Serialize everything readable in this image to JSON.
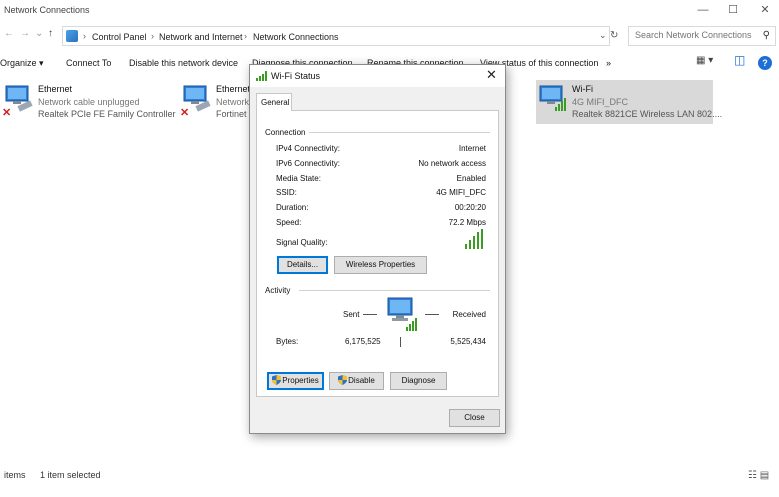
{
  "window": {
    "title": "Network Connections",
    "controls": {
      "minimize": "—",
      "maximize": "☐",
      "close": "✕"
    }
  },
  "address": {
    "back": "←",
    "forward": "→",
    "recent": "⌄",
    "up": "↑",
    "breadcrumbs": [
      "Control Panel",
      "Network and Internet",
      "Network Connections"
    ],
    "separator": "›",
    "dropdown": "⌄",
    "refresh": "↻",
    "search_placeholder": "Search Network Connections",
    "search_icon": "⚲"
  },
  "toolbar": {
    "organize": "Organize ▾",
    "connect_to": "Connect To",
    "disable": "Disable this network device",
    "diagnose": "Diagnose this connection",
    "rename": "Rename this connection",
    "view_status": "View status of this connection",
    "more": "»",
    "view_icon": "▦ ▾",
    "pane_icon": "◫",
    "help": "?"
  },
  "connections": [
    {
      "name": "Ethernet",
      "status": "Network cable unplugged",
      "device": "Realtek PCIe FE Family Controller",
      "error": "✕"
    },
    {
      "name": "Ethernet",
      "status": "Network",
      "device": "Fortinet",
      "error": "✕"
    },
    {
      "name": "Wi-Fi",
      "status": "4G MIFI_DFC",
      "device": "Realtek 8821CE Wireless LAN 802...."
    }
  ],
  "status_bar": {
    "items": "items",
    "selected": "1 item selected",
    "view_icons": "☷ ▤"
  },
  "dialog": {
    "title": "Wi-Fi Status",
    "close": "✕",
    "tab": "General",
    "connection_header": "Connection",
    "rows": [
      {
        "label": "IPv4 Connectivity:",
        "value": "Internet"
      },
      {
        "label": "IPv6 Connectivity:",
        "value": "No network access"
      },
      {
        "label": "Media State:",
        "value": "Enabled"
      },
      {
        "label": "SSID:",
        "value": "4G MIFI_DFC"
      },
      {
        "label": "Duration:",
        "value": "00:20:20"
      },
      {
        "label": "Speed:",
        "value": "72.2 Mbps"
      }
    ],
    "signal_label": "Signal Quality:",
    "details_button": "Details...",
    "wireless_button": "Wireless Properties",
    "activity_header": "Activity",
    "sent_label": "Sent",
    "received_label": "Received",
    "bytes_label": "Bytes:",
    "bytes_sent": "6,175,525",
    "bytes_received": "5,525,434",
    "properties_button": "Properties",
    "disable_button": "Disable",
    "diagnose_button": "Diagnose",
    "close_button": "Close"
  }
}
